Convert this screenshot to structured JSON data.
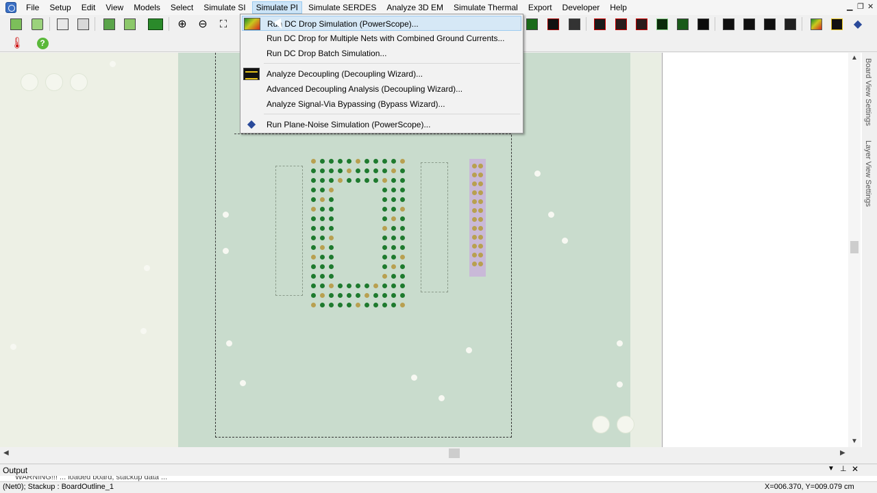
{
  "menubar": {
    "items": [
      "File",
      "Setup",
      "Edit",
      "View",
      "Models",
      "Select",
      "Simulate SI",
      "Simulate PI",
      "Simulate SERDES",
      "Analyze 3D EM",
      "Simulate Thermal",
      "Export",
      "Developer",
      "Help"
    ],
    "active_index": 7,
    "window_controls": [
      "minimize-icon",
      "restore-icon",
      "close-icon"
    ]
  },
  "toolbar": {
    "icons": [
      "open-file-icon",
      "save-icon",
      "print-preview-icon",
      "print-icon",
      "copy-layer-icon",
      "paste-icon",
      "grid-icon",
      "zoom-in-icon",
      "zoom-out-icon",
      "zoom-fit-icon"
    ],
    "right_icons": [
      "layer-view-icon",
      "trace-icon",
      "stackup-icon",
      "sim-result-icon",
      "graph-icon",
      "pattern-icon",
      "waveform-icon",
      "eye-diagram-icon",
      "scope-icon"
    ],
    "second_row": [
      "probe-icon",
      "help-icon"
    ]
  },
  "simulate_pi_menu": {
    "groups": [
      {
        "icon": "dc-drop-icon",
        "items": [
          "Run DC Drop Simulation (PowerScope)...",
          "Run DC Drop for Multiple Nets with Combined Ground Currents...",
          "Run DC Drop Batch Simulation..."
        ]
      },
      {
        "icon": "decoupling-wizard-icon",
        "items": [
          "Analyze Decoupling (Decoupling Wizard)...",
          "Advanced Decoupling Analysis (Decoupling Wizard)...",
          "Analyze Signal-Via Bypassing (Bypass Wizard)..."
        ]
      },
      {
        "icon": "powerscope-noise-icon",
        "items": [
          "Run Plane-Noise Simulation (PowerScope)..."
        ]
      }
    ],
    "highlighted": "Run DC Drop Simulation (PowerScope)..."
  },
  "side_tabs": [
    "Board View Settings",
    "Layer View Settings"
  ],
  "output": {
    "title": "Output",
    "text": "WARNING!!! ... loaded board, stackup data ..."
  },
  "status": {
    "left": "(Net0); Stackup : BoardOutline_1",
    "right": "X=006.370, Y=009.079 cm"
  },
  "colors": {
    "board_main": "#c9dccd",
    "board_side": "#edf0e5",
    "pad_green": "#1e7a2e",
    "menu_highlight": "#d6e8f6"
  }
}
